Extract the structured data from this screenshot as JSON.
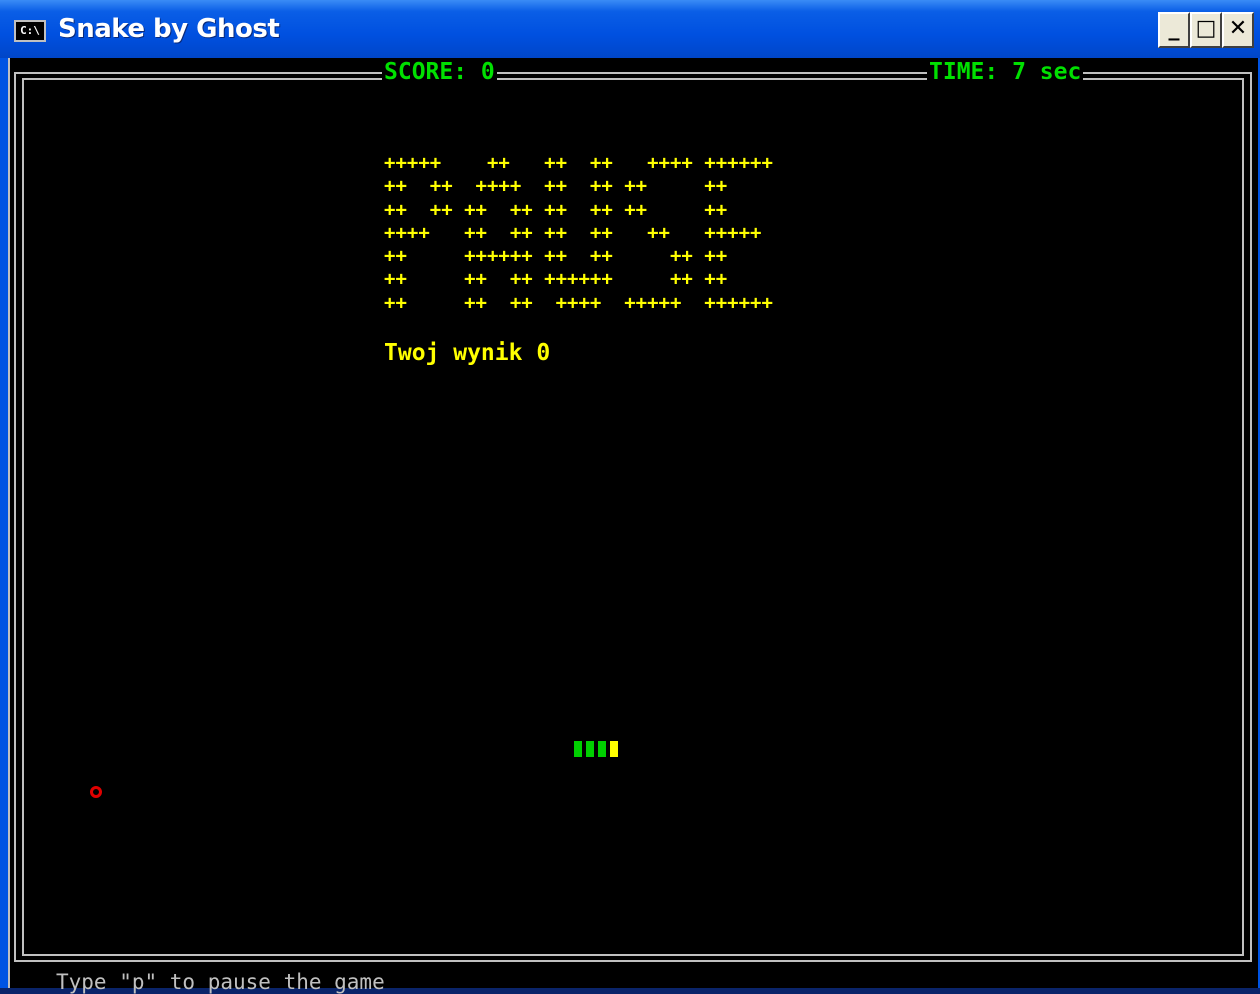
{
  "window": {
    "title": "Snake by Ghost",
    "icon_text": "C:\\",
    "buttons": {
      "minimize": "_",
      "maximize": "□",
      "close": "✕"
    }
  },
  "hud": {
    "score": "SCORE: 0",
    "time": "TIME: 7 sec"
  },
  "game_over": {
    "logo_lines": [
      "+++++    ++   ++  ++   ++++ ++++++",
      "++  ++  ++++  ++  ++ ++     ++",
      "++  ++ ++  ++ ++  ++ ++     ++",
      "++++   ++  ++ ++  ++   ++   +++++",
      "++     ++++++ ++  ++     ++ ++",
      "++     ++  ++ ++++++     ++ ++",
      "++     ++  ++  ++++  +++++  ++++++"
    ],
    "your_score": "Twoj wynik 0"
  },
  "hint": "Type \"p\" to pause the game",
  "colors": {
    "background": "#000000",
    "hud": "#00e000",
    "logo": "#ffff00",
    "snake_body": "#00d000",
    "snake_head": "#ffff00",
    "food": "#e00000",
    "frame": "#c0c0c0"
  }
}
